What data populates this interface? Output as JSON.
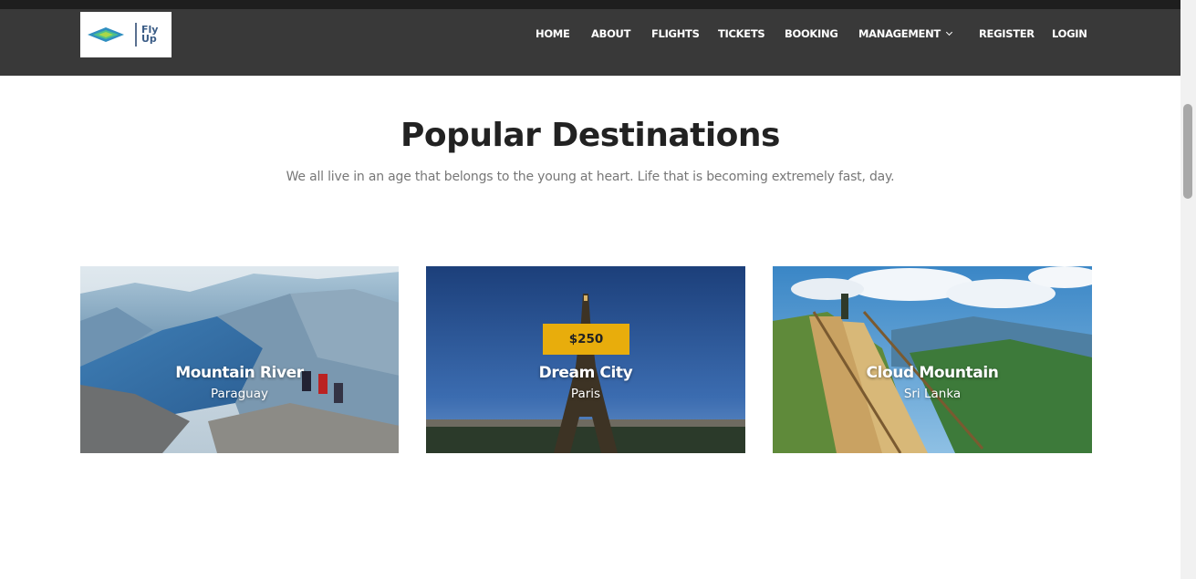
{
  "brand": {
    "logo_text_line1": "Fly",
    "logo_text_line2": "Up"
  },
  "nav": {
    "items": [
      "HOME",
      "ABOUT",
      "FLIGHTS",
      "TICKETS",
      "BOOKING",
      "MANAGEMENT",
      "REGISTER",
      "LOGIN"
    ]
  },
  "section": {
    "title": "Popular Destinations",
    "subtitle": "We all live in an age that belongs to the young at heart. Life that is becoming extremely fast, day."
  },
  "destinations": [
    {
      "name": "Mountain River",
      "location": "Paraguay"
    },
    {
      "name": "Dream City",
      "location": "Paris",
      "price": "$250"
    },
    {
      "name": "Cloud Mountain",
      "location": "Sri Lanka"
    }
  ],
  "colors": {
    "header_bg": "#393939",
    "accent": "#e8ad0c",
    "title": "#222222",
    "subtitle": "#777777"
  }
}
